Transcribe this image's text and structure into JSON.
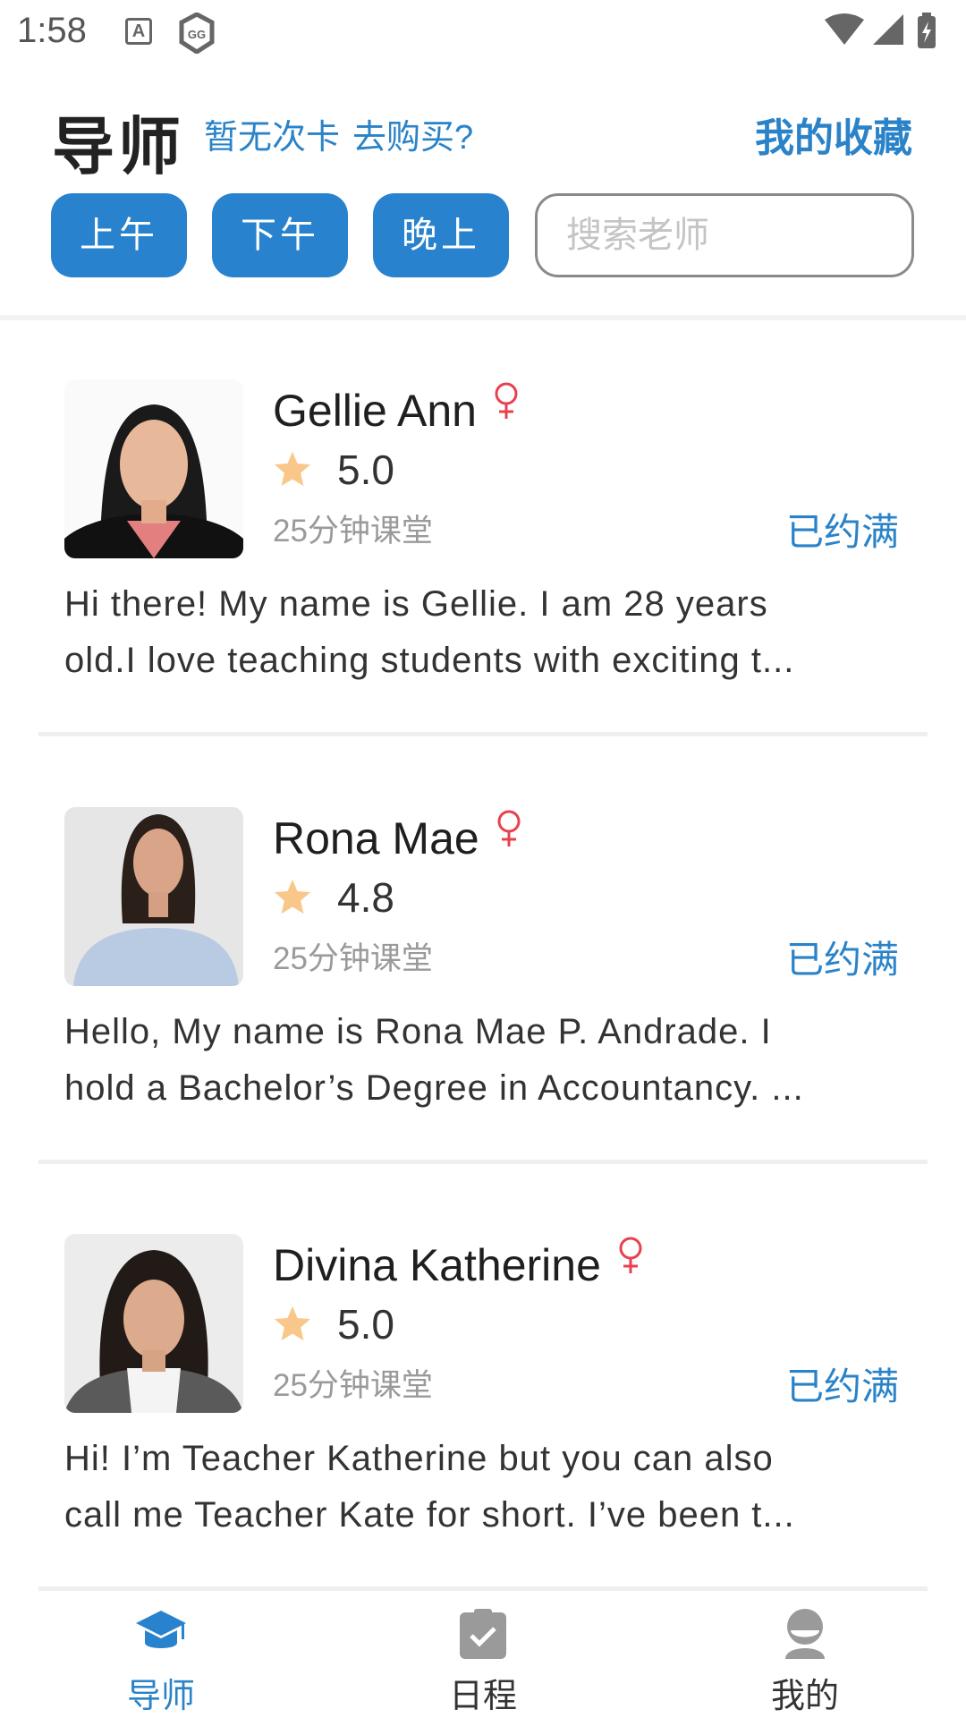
{
  "status_bar": {
    "time": "1:58",
    "a_icon": "A",
    "gg_icon": "GG"
  },
  "header": {
    "title": "导师",
    "card_status": "暂无次卡",
    "buy_link": "去购买?",
    "favorites": "我的收藏"
  },
  "filters": {
    "morning": "上午",
    "afternoon": "下午",
    "evening": "晚上",
    "search_placeholder": "搜索老师"
  },
  "tutors": [
    {
      "name": "Gellie Ann",
      "gender": "female",
      "rating": "5.0",
      "duration": "25分钟课堂",
      "status": "已约满",
      "intro": "Hi there! My name is Gellie. I am 28 years\nold.I love teaching students with exciting t..."
    },
    {
      "name": "Rona Mae",
      "gender": "female",
      "rating": "4.8",
      "duration": "25分钟课堂",
      "status": "已约满",
      "intro": "Hello, My name is Rona Mae P. Andrade. I\nhold a Bachelor’s Degree in Accountancy. ..."
    },
    {
      "name": "Divina Katherine",
      "gender": "female",
      "rating": "5.0",
      "duration": "25分钟课堂",
      "status": "已约满",
      "intro": "Hi! I’m Teacher Katherine but you can also\ncall me Teacher Kate for short. I’ve been t..."
    }
  ],
  "bottom_nav": {
    "tutors": "导师",
    "schedule": "日程",
    "mine": "我的"
  },
  "colors": {
    "accent": "#2A83C8",
    "button": "#2882CD",
    "star": "#F9C78A",
    "female": "#E8414E"
  },
  "icons": [
    "wifi-icon",
    "signal-icon",
    "battery-icon",
    "star-icon",
    "female-icon",
    "graduation-cap-icon",
    "clipboard-check-icon",
    "user-icon"
  ]
}
